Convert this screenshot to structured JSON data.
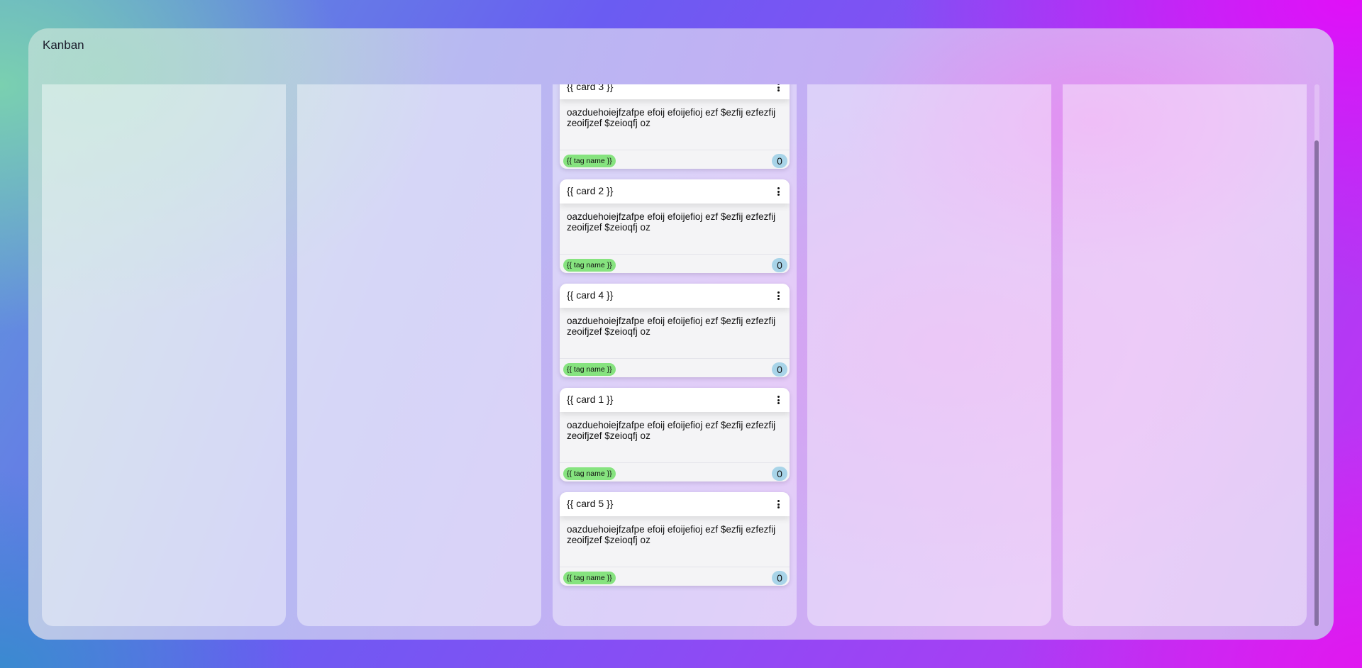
{
  "app": {
    "title": "Kanban"
  },
  "board": {
    "columns": [
      {
        "cards": []
      },
      {
        "cards": []
      },
      {
        "cards": [
          {
            "title": "{{ card 3 }}",
            "description": "oazduehoiejfzafpe efoij efoijefioj ezf $ezfij ezfezfij zeoifjzef $zeioqfj oz",
            "tag": "{{ tag name }}",
            "count": "0"
          },
          {
            "title": "{{ card 2 }}",
            "description": "oazduehoiejfzafpe efoij efoijefioj ezf $ezfij ezfezfij zeoifjzef $zeioqfj oz",
            "tag": "{{ tag name }}",
            "count": "0"
          },
          {
            "title": "{{ card 4 }}",
            "description": "oazduehoiejfzafpe efoij efoijefioj ezf $ezfij ezfezfij zeoifjzef $zeioqfj oz",
            "tag": "{{ tag name }}",
            "count": "0"
          },
          {
            "title": "{{ card 1 }}",
            "description": "oazduehoiejfzafpe efoij efoijefioj ezf $ezfij ezfezfij zeoifjzef $zeioqfj oz",
            "tag": "{{ tag name }}",
            "count": "0"
          },
          {
            "title": "{{ card 5 }}",
            "description": "oazduehoiejfzafpe efoij efoijefioj ezf $ezfij ezfezfij zeoifjzef $zeioqfj oz",
            "tag": "{{ tag name }}",
            "count": "0"
          }
        ]
      },
      {
        "cards": []
      },
      {
        "cards": []
      }
    ]
  },
  "colors": {
    "tag": "#86e37f",
    "count_badge": "#a8d4e8"
  },
  "icons": {
    "card_menu": "more-vert-icon"
  }
}
